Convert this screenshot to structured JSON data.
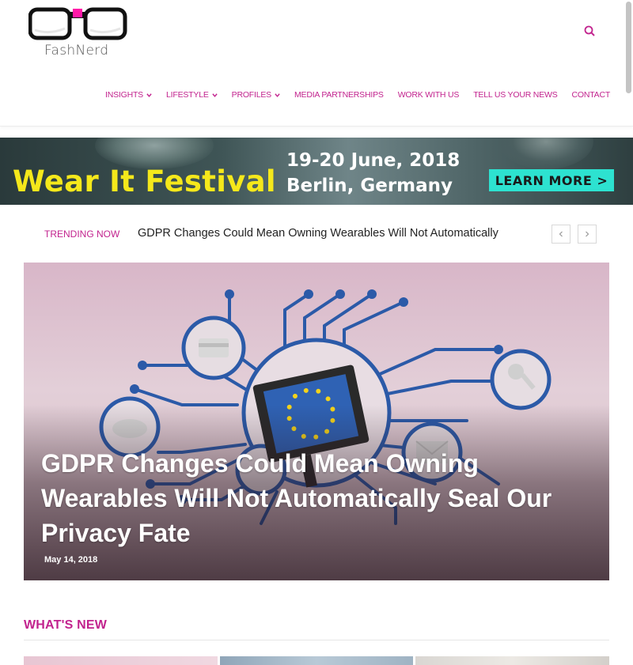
{
  "site": {
    "logo_text": "FashNerd",
    "accent": "#c2238e"
  },
  "nav": {
    "items": [
      {
        "label": "INSIGHTS",
        "dropdown": true
      },
      {
        "label": "LIFESTYLE",
        "dropdown": true
      },
      {
        "label": "PROFILES",
        "dropdown": true
      },
      {
        "label": "MEDIA PARTNERSHIPS",
        "dropdown": false
      },
      {
        "label": "WORK WITH US",
        "dropdown": false
      },
      {
        "label": "TELL US YOUR NEWS",
        "dropdown": false
      },
      {
        "label": "CONTACT",
        "dropdown": false
      }
    ],
    "search_icon": "search-icon"
  },
  "banner": {
    "title": "Wear It Festival",
    "date": "19-20 June, 2018",
    "place": "Berlin, Germany",
    "cta": "LEARN MORE >",
    "title_color": "#f5e81b",
    "cta_color": "#2de2d0"
  },
  "trending": {
    "label": "TRENDING NOW",
    "headline": "GDPR Changes Could Mean Owning Wearables Will Not Automatically"
  },
  "hero": {
    "title": "GDPR Changes Could Mean Owning Wearables Will Not Automatically Seal Our Privacy Fate",
    "date": "May 14, 2018"
  },
  "whats_new": {
    "heading": "WHAT'S NEW"
  }
}
